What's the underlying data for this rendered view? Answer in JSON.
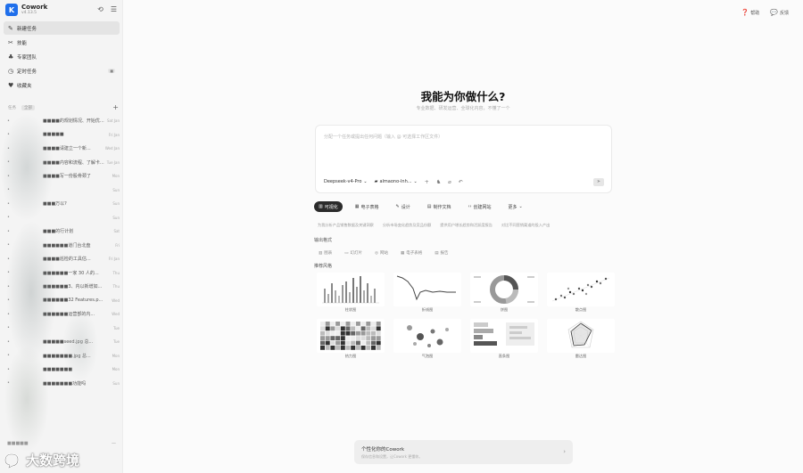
{
  "app": {
    "name": "Cowork",
    "version": "v4.13.5"
  },
  "sidebar": {
    "nav": [
      {
        "label": "新建任务",
        "icon": "edit-icon",
        "active": true
      },
      {
        "label": "技能",
        "icon": "tools-icon"
      },
      {
        "label": "专家团队",
        "icon": "team-icon"
      },
      {
        "label": "定时任务",
        "icon": "clock-icon",
        "badge": "■"
      },
      {
        "label": "收藏夹",
        "icon": "heart-icon"
      }
    ],
    "section_label": "任务",
    "section_pill": "全部",
    "history": [
      {
        "text": "■■■■的规划情况、开始优...",
        "time": "Sat Jan"
      },
      {
        "text": "■■■■■",
        "time": "Fri Jan"
      },
      {
        "text": "■■■■请建立一个新...",
        "time": "Wed Jan"
      },
      {
        "text": "■■■■内容和流程、了解卡...",
        "time": "Tue Jan"
      },
      {
        "text": "■■■■写一份股骨颈了",
        "time": "Mon"
      },
      {
        "text": "",
        "time": "Sun"
      },
      {
        "text": "■■■万以?",
        "time": "Sun"
      },
      {
        "text": "",
        "time": "Sun"
      },
      {
        "text": "■■■的行计划",
        "time": "Sat"
      },
      {
        "text": "■■■■■■道门台北盘",
        "time": "Fri"
      },
      {
        "text": "■■■■巡检的工具估...",
        "time": "Fri Jan"
      },
      {
        "text": "■■■■■■一家 30 人的...",
        "time": "Thu"
      },
      {
        "text": "■■■■■■3、内以新增如...",
        "time": "Thu"
      },
      {
        "text": "■■■■■■32 Features.p...",
        "time": "Wed"
      },
      {
        "text": "■■■■■■运营部的内...",
        "time": "Wed"
      },
      {
        "text": "",
        "time": "Tue"
      },
      {
        "text": "■■■■■seed.jpg 总...",
        "time": "Tue"
      },
      {
        "text": "■■■■■■■.jpg 总...",
        "time": "Mon"
      },
      {
        "text": "■■■■■■■",
        "time": "Mon"
      },
      {
        "text": "■■■■■■■功能吗",
        "time": "Sun"
      }
    ],
    "footer": "■■■■■"
  },
  "topbar": {
    "help": "帮助",
    "feedback": "反馈"
  },
  "main": {
    "title": "我能为你做什么?",
    "subtitle": "专业数据、研发运营、全球化内容，不懂了一个",
    "composer_placeholder": "分配一个任务或提出任何问题（输入 @ 可选择工作区文件）",
    "model": "Deepseek-v4-Pro",
    "workspace": "almaono-lnh...",
    "tabs": [
      {
        "label": "可视化",
        "icon": "chart-icon",
        "active": true
      },
      {
        "label": "电子表格",
        "icon": "table-icon"
      },
      {
        "label": "设计",
        "icon": "design-icon"
      },
      {
        "label": "制作文档",
        "icon": "doc-icon"
      },
      {
        "label": "创建网站",
        "icon": "code-icon"
      },
      {
        "label": "更多",
        "icon": "chevron-down-icon"
      }
    ],
    "suggestions": [
      "为我分析产品销售数据及关键洞察",
      "分析市场变化趋势及竞品份额",
      "提供用户增长趋势和活跃度报告",
      "对比不同营销渠道的投入产出"
    ],
    "output_label": "输出格式",
    "output_options": [
      "图表",
      "幻灯片",
      "网站",
      "电子表格",
      "报告"
    ],
    "recommend_label": "推荐风格",
    "charts": [
      {
        "label": "柱状图",
        "kind": "bars"
      },
      {
        "label": "折线图",
        "kind": "line"
      },
      {
        "label": "饼图",
        "kind": "donut"
      },
      {
        "label": "散点图",
        "kind": "scatter"
      },
      {
        "label": "热力图",
        "kind": "heatmap"
      },
      {
        "label": "气泡图",
        "kind": "bubble"
      },
      {
        "label": "直条图",
        "kind": "hbars"
      },
      {
        "label": "雷达图",
        "kind": "radar"
      }
    ],
    "promo_title": "个性化你的Cowork",
    "promo_sub": "保存信息和设置，让Cowork 更懂你。"
  },
  "watermark": "大数跨境",
  "colors": {
    "accent": "#1f6feb",
    "active_tab": "#2b2b2b"
  }
}
